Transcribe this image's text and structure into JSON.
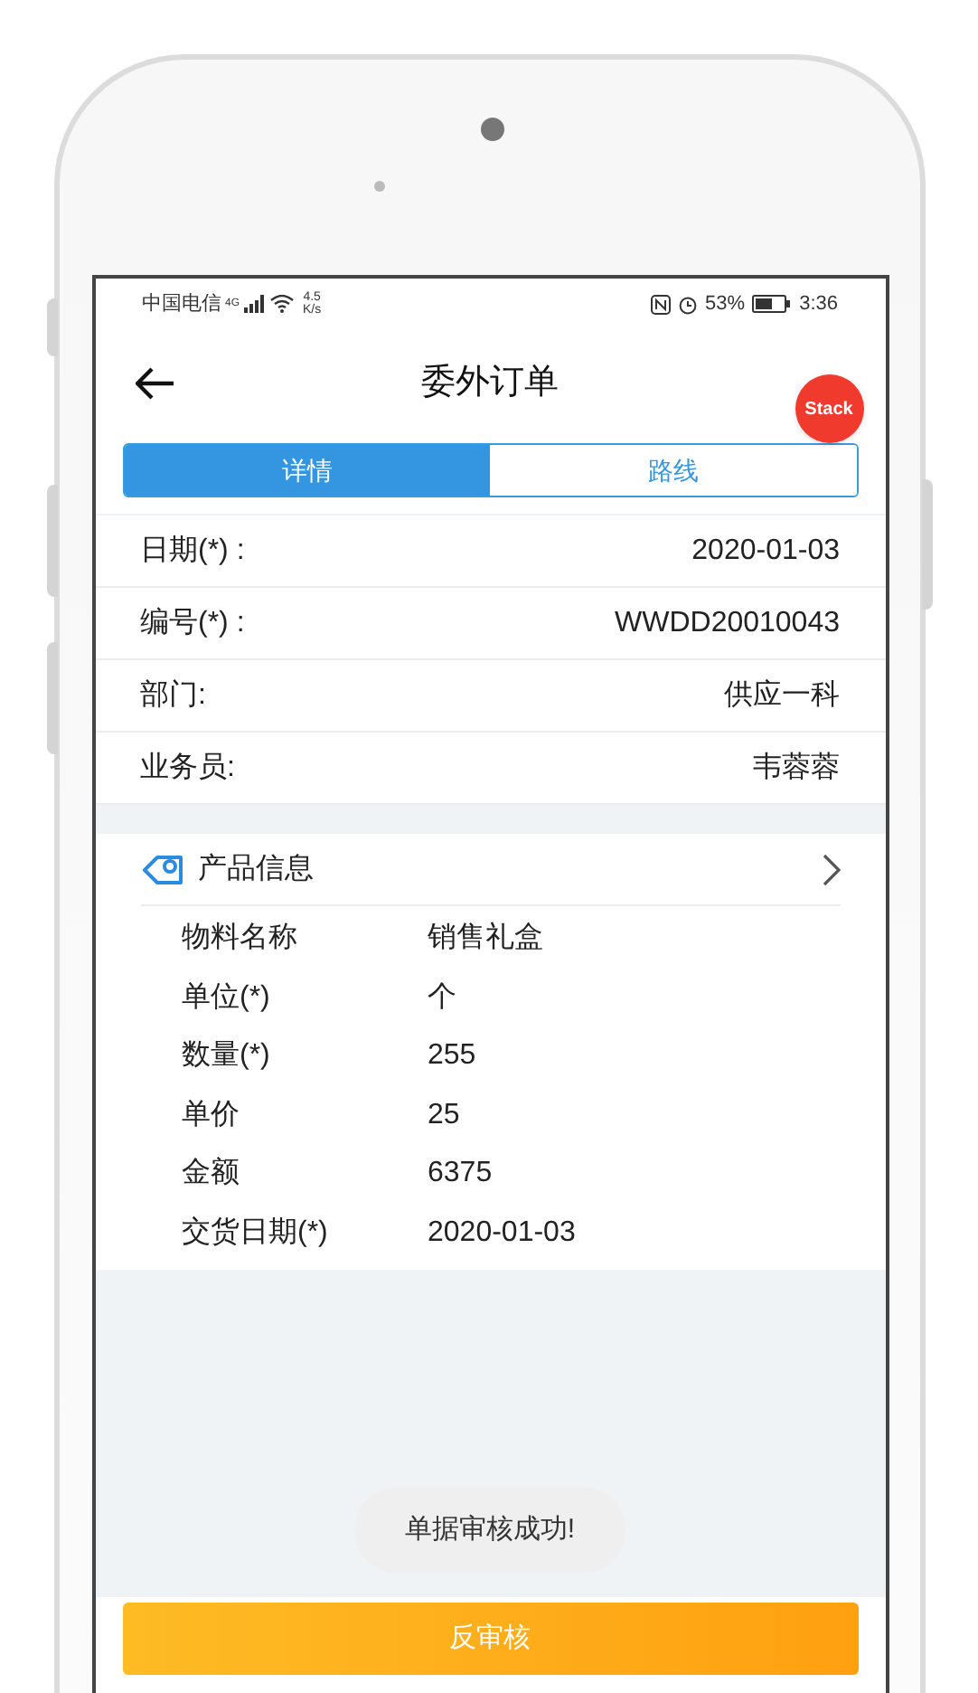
{
  "status_bar": {
    "carrier": "中国电信",
    "network": "4G",
    "speed": "4.5",
    "speed_unit": "K/s",
    "battery": "53%",
    "time": "3:36"
  },
  "header": {
    "title": "委外订单",
    "badge": "Stack"
  },
  "tabs": [
    {
      "label": "详情",
      "selected": true
    },
    {
      "label": "路线",
      "selected": false
    }
  ],
  "fields": [
    {
      "label": "日期(*) :",
      "value": "2020-01-03"
    },
    {
      "label": "编号(*) :",
      "value": "WWDD20010043"
    },
    {
      "label": "部门:",
      "value": "供应一科"
    },
    {
      "label": "业务员:",
      "value": "韦蓉蓉"
    }
  ],
  "product": {
    "title": "产品信息",
    "items": [
      {
        "label": "物料名称",
        "value": "销售礼盒"
      },
      {
        "label": "单位(*)",
        "value": "个"
      },
      {
        "label": "数量(*)",
        "value": "255"
      },
      {
        "label": "单价",
        "value": "25"
      },
      {
        "label": "金额",
        "value": "6375"
      },
      {
        "label": "交货日期(*)",
        "value": "2020-01-03"
      }
    ]
  },
  "toast": "单据审核成功!",
  "action_button": "反审核"
}
